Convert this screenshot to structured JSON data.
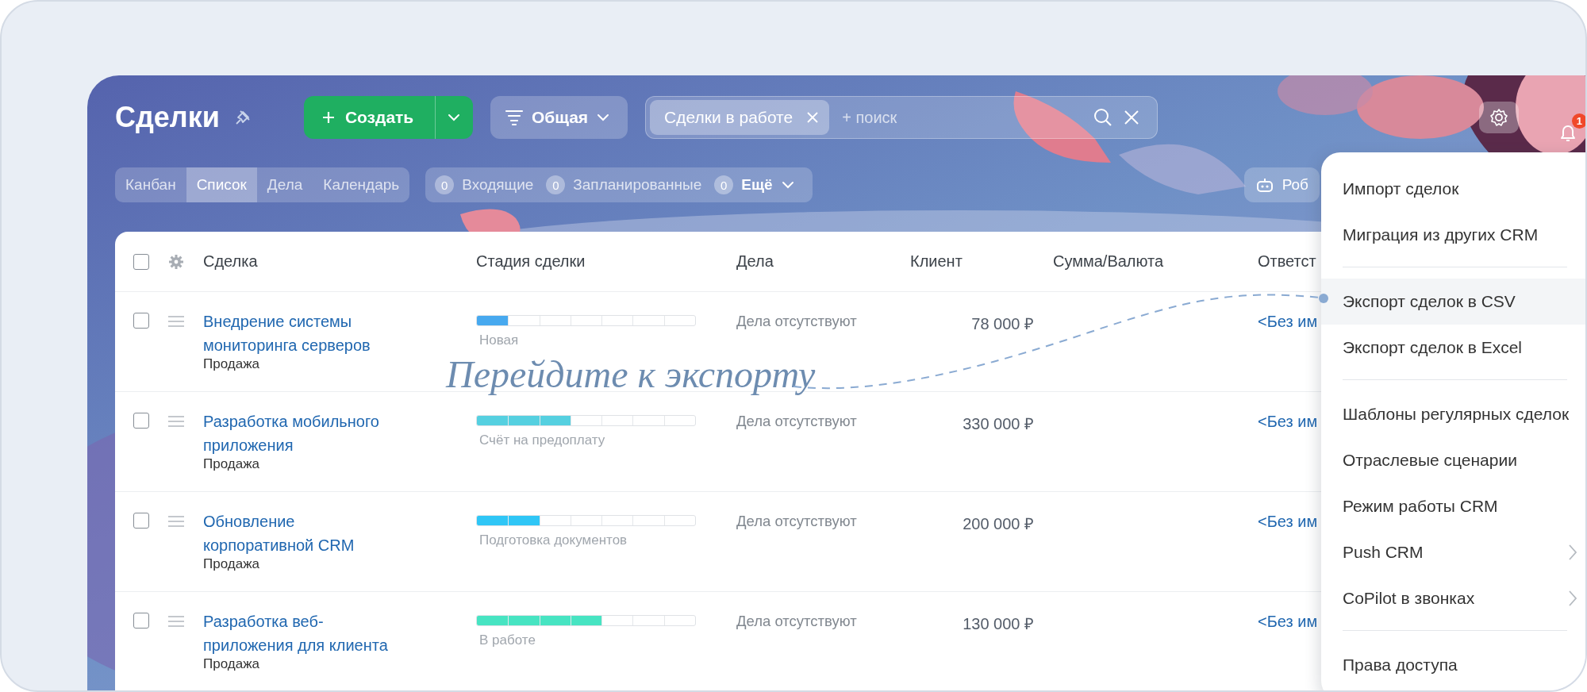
{
  "header": {
    "title": "Сделки",
    "create_button": "Создать",
    "filter_button": "Общая",
    "search": {
      "chip": "Сделки в работе",
      "placeholder": "+ поиск"
    },
    "notifications_badge": "1"
  },
  "view_tabs": [
    {
      "label": "Канбан",
      "selected": false
    },
    {
      "label": "Список",
      "selected": true
    },
    {
      "label": "Дела",
      "selected": false
    },
    {
      "label": "Календарь",
      "selected": false
    }
  ],
  "counters": [
    {
      "kind": "filter",
      "count": "0",
      "label": "Входящие"
    },
    {
      "kind": "filter",
      "count": "0",
      "label": "Запланированные"
    },
    {
      "kind": "more",
      "count": "0",
      "label": "Ещё"
    }
  ],
  "robot_button": "Роб",
  "table": {
    "select_all_checked": false,
    "columns": [
      "Сделка",
      "Стадия сделки",
      "Дела",
      "Клиент",
      "Сумма/Валюта",
      "Ответст"
    ],
    "rows": [
      {
        "checked": false,
        "title": "Внедрение системы\nмониторинга серверов",
        "type": "Продажа",
        "stage": {
          "label": "Новая",
          "level": 0.143,
          "color": "#47a9ef"
        },
        "activities": "Дела отсутствуют",
        "amount": "78 000 ₽",
        "responsible": "<Без им"
      },
      {
        "checked": false,
        "title": "Разработка мобильного\nприложения",
        "type": "Продажа",
        "stage": {
          "label": "Счёт на предоплату",
          "level": 0.429,
          "color": "#55d0e0"
        },
        "activities": "Дела отсутствуют",
        "amount": "330 000 ₽",
        "responsible": "<Без им"
      },
      {
        "checked": false,
        "title": "Обновление\nкорпоративной CRM",
        "type": "Продажа",
        "stage": {
          "label": "Подготовка документов",
          "level": 0.286,
          "color": "#2fc6f6"
        },
        "activities": "Дела отсутствуют",
        "amount": "200 000 ₽",
        "responsible": "<Без им"
      },
      {
        "checked": false,
        "title": "Разработка веб-\nприложения для клиента",
        "type": "Продажа",
        "stage": {
          "label": "В работе",
          "level": 0.571,
          "color": "#47e4c2"
        },
        "activities": "Дела отсутствуют",
        "amount": "130 000 ₽",
        "responsible": "<Без им"
      }
    ]
  },
  "menu": {
    "groups": [
      {
        "items": [
          {
            "label": "Импорт сделок",
            "selected": false,
            "has_submenu": false
          },
          {
            "label": "Миграция из других CRM",
            "selected": false,
            "has_submenu": false
          }
        ]
      },
      {
        "items": [
          {
            "label": "Экспорт сделок в CSV",
            "selected": true,
            "has_submenu": false
          },
          {
            "label": "Экспорт сделок в Excel",
            "selected": false,
            "has_submenu": false
          }
        ]
      },
      {
        "items": [
          {
            "label": "Шаблоны регулярных сделок",
            "selected": false,
            "has_submenu": false
          },
          {
            "label": "Отраслевые сценарии",
            "selected": false,
            "has_submenu": false
          },
          {
            "label": "Режим работы CRM",
            "selected": false,
            "has_submenu": false
          },
          {
            "label": "Push CRM",
            "selected": false,
            "has_submenu": true
          },
          {
            "label": "CoPilot в звонках",
            "selected": false,
            "has_submenu": true
          }
        ]
      },
      {
        "items": [
          {
            "label": "Права доступа",
            "selected": false,
            "has_submenu": false
          }
        ]
      }
    ]
  },
  "annotation": "Перейдите к экспорту"
}
